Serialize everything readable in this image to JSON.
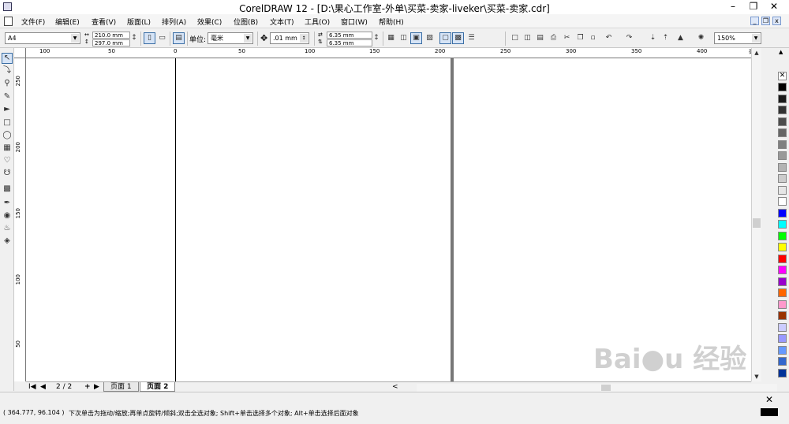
{
  "window": {
    "title": "CorelDRAW 12 - [D:\\果心工作室-外单\\买菜-卖家-liveker\\买菜-卖家.cdr]",
    "minimize": "–",
    "restore": "❐",
    "close": "✕"
  },
  "menu": {
    "items": [
      "文件(F)",
      "编辑(E)",
      "查看(V)",
      "版面(L)",
      "排列(A)",
      "效果(C)",
      "位图(B)",
      "文本(T)",
      "工具(O)",
      "窗口(W)",
      "帮助(H)"
    ],
    "doc_min": "_",
    "doc_restore": "❐",
    "doc_close": "x"
  },
  "propbar": {
    "paper_size": "A4",
    "width": "210.0 mm",
    "height": "297.0 mm",
    "units_label": "单位:",
    "units": "毫米",
    "nudge": ".01 mm",
    "dup_x": "6.35 mm",
    "dup_y": "6.35 mm",
    "zoom": "150%"
  },
  "ruler": {
    "top_labels": [
      "100",
      "50",
      "0",
      "50",
      "100",
      "150",
      "200",
      "250",
      "300",
      "350",
      "400"
    ],
    "unit": "毫米",
    "left_labels": [
      "250",
      "200",
      "150",
      "100",
      "50"
    ]
  },
  "pagebar": {
    "first": "I◀",
    "prev": "◀",
    "counter": "2 / 2",
    "add": "+",
    "next": "▶",
    "last": "▶I",
    "tabs": [
      "页面 1",
      "页面 2"
    ],
    "scroll_left": "<"
  },
  "status": {
    "coords": "( 364.777, 96.104 )",
    "hint": "下次单击为拖动/缩放;再单点旋转/倾斜;双击全选对象; Shift+单击选择多个对象; Alt+单击选择后面对象"
  },
  "palette": {
    "colors": [
      "#000000",
      "#1a1a1a",
      "#333333",
      "#4d4d4d",
      "#666666",
      "#808080",
      "#999999",
      "#b3b3b3",
      "#cccccc",
      "#e6e6e6",
      "#ffffff",
      "#0000ff",
      "#00ffff",
      "#00ff00",
      "#ffff00",
      "#ff0000",
      "#ff00ff",
      "#9900cc",
      "#ff6600",
      "#ff99cc",
      "#993300",
      "#ccccff",
      "#9999ff",
      "#6699ff",
      "#3366cc",
      "#003399"
    ]
  },
  "colors": {
    "page_border": "#000000",
    "spread_gap": "#777777"
  }
}
